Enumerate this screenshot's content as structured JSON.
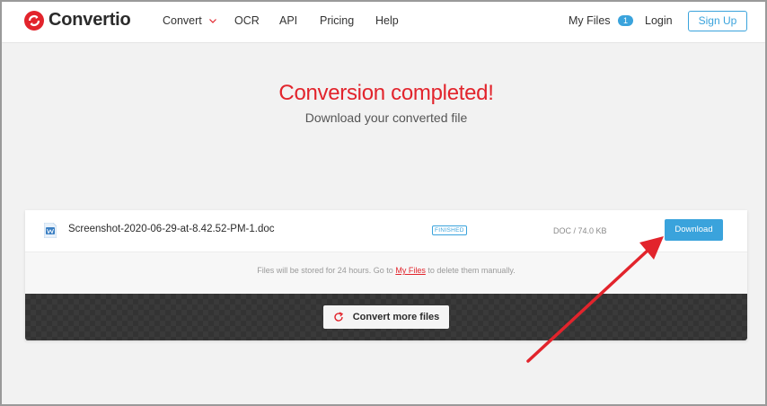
{
  "brand": {
    "name": "Convertio",
    "accent": "#e2242c"
  },
  "nav": {
    "convert_label": "Convert",
    "ocr_label": "OCR",
    "api_label": "API",
    "pricing_label": "Pricing",
    "help_label": "Help",
    "my_files_label": "My Files",
    "my_files_count": "1",
    "login_label": "Login",
    "signup_label": "Sign Up"
  },
  "hero": {
    "title": "Conversion completed!",
    "subtitle": "Download your converted file"
  },
  "file": {
    "icon": "word-doc-icon",
    "name": "Screenshot-2020-06-29-at-8.42.52-PM-1.doc",
    "status": "FINISHED",
    "meta": "DOC / 74.0 KB",
    "download_label": "Download"
  },
  "storage_note": {
    "prefix": "Files will be stored for 24 hours. Go to",
    "link": "My Files",
    "suffix": "to delete them manually."
  },
  "convert_more": {
    "label": "Convert more files",
    "icon": "refresh-icon"
  },
  "colors": {
    "blue": "#3aa3dc",
    "red": "#e2242c",
    "dark_bar": "#3a3a3a"
  }
}
